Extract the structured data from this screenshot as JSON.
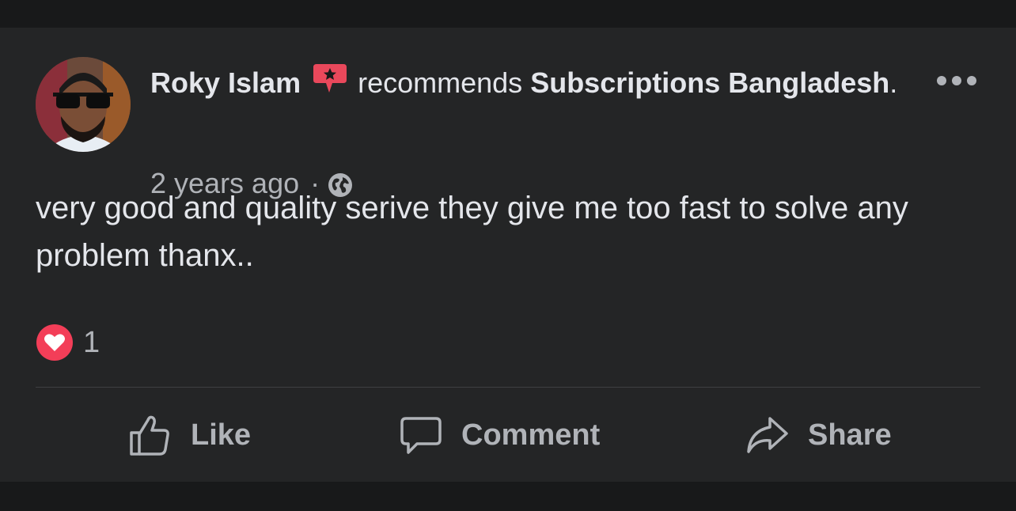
{
  "post": {
    "author": "Roky Islam",
    "verb": "recommends",
    "page_name": "Subscriptions Bangladesh",
    "page_suffix": ".",
    "timestamp": "2 years ago",
    "separator": "·",
    "privacy_icon": "globe-icon",
    "body": "very good and quality serive they give me too fast to solve any problem thanx..",
    "reaction_icon": "love-reaction-icon",
    "reaction_count": "1"
  },
  "actions": {
    "like_label": "Like",
    "comment_label": "Comment",
    "share_label": "Share"
  },
  "colors": {
    "background": "#18191a",
    "card": "#242526",
    "text_primary": "#e4e6eb",
    "text_secondary": "#b0b3b8",
    "recommend_badge": "#e9485b",
    "love_red": "#f33e58"
  }
}
